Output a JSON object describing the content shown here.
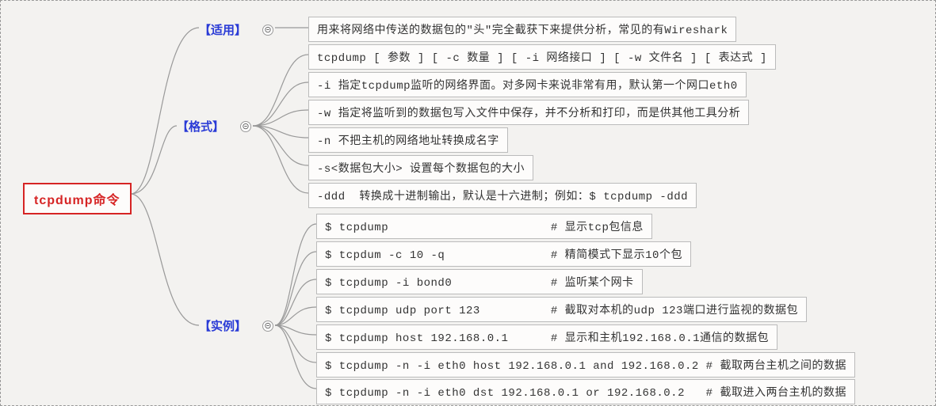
{
  "root": {
    "title": "tcpdump命令"
  },
  "branches": {
    "usage": {
      "label": "【适用】"
    },
    "format": {
      "label": "【格式】"
    },
    "example": {
      "label": "【实例】"
    }
  },
  "collapse_glyph": "⊝",
  "leaves": {
    "usage_1": "用来将网络中传送的数据包的\"头\"完全截获下来提供分析，常见的有Wireshark",
    "fmt_1": "tcpdump [ 参数 ] [ -c 数量 ] [ -i 网络接口 ] [ -w 文件名 ] [ 表达式 ]",
    "fmt_2": "-i 指定tcpdump监听的网络界面。对多网卡来说非常有用，默认第一个网口eth0",
    "fmt_3": "-w 指定将监听到的数据包写入文件中保存，并不分析和打印，而是供其他工具分析",
    "fmt_4": "-n 不把主机的网络地址转换成名字",
    "fmt_5": "-s<数据包大小> 设置每个数据包的大小",
    "fmt_6": "-ddd  转换成十进制输出，默认是十六进制；例如：$ tcpdump -ddd",
    "ex_1": "$ tcpdump                       # 显示tcp包信息",
    "ex_2": "$ tcpdum -c 10 -q               # 精简模式下显示10个包",
    "ex_3": "$ tcpdump -i bond0              # 监听某个网卡",
    "ex_4": "$ tcpdump udp port 123          # 截取对本机的udp 123端口进行监视的数据包",
    "ex_5": "$ tcpdump host 192.168.0.1      # 显示和主机192.168.0.1通信的数据包",
    "ex_6": "$ tcpdump -n -i eth0 host 192.168.0.1 and 192.168.0.2 # 截取两台主机之间的数据",
    "ex_7": "$ tcpdump -n -i eth0 dst 192.168.0.1 or 192.168.0.2   # 截取进入两台主机的数据"
  },
  "chart_data": {
    "type": "table",
    "title": "tcpdump命令 mindmap",
    "root": "tcpdump命令",
    "children": [
      {
        "label": "【适用】",
        "items": [
          "用来将网络中传送的数据包的\"头\"完全截获下来提供分析，常见的有Wireshark"
        ]
      },
      {
        "label": "【格式】",
        "items": [
          "tcpdump [ 参数 ] [ -c 数量 ] [ -i 网络接口 ] [ -w 文件名 ] [ 表达式 ]",
          "-i 指定tcpdump监听的网络界面。对多网卡来说非常有用，默认第一个网口eth0",
          "-w 指定将监听到的数据包写入文件中保存，并不分析和打印，而是供其他工具分析",
          "-n 不把主机的网络地址转换成名字",
          "-s<数据包大小> 设置每个数据包的大小",
          "-ddd  转换成十进制输出，默认是十六进制；例如：$ tcpdump -ddd"
        ]
      },
      {
        "label": "【实例】",
        "items": [
          "$ tcpdump                       # 显示tcp包信息",
          "$ tcpdum -c 10 -q               # 精简模式下显示10个包",
          "$ tcpdump -i bond0              # 监听某个网卡",
          "$ tcpdump udp port 123          # 截取对本机的udp 123端口进行监视的数据包",
          "$ tcpdump host 192.168.0.1      # 显示和主机192.168.0.1通信的数据包",
          "$ tcpdump -n -i eth0 host 192.168.0.1 and 192.168.0.2 # 截取两台主机之间的数据",
          "$ tcpdump -n -i eth0 dst 192.168.0.1 or 192.168.0.2   # 截取进入两台主机的数据"
        ]
      }
    ]
  }
}
